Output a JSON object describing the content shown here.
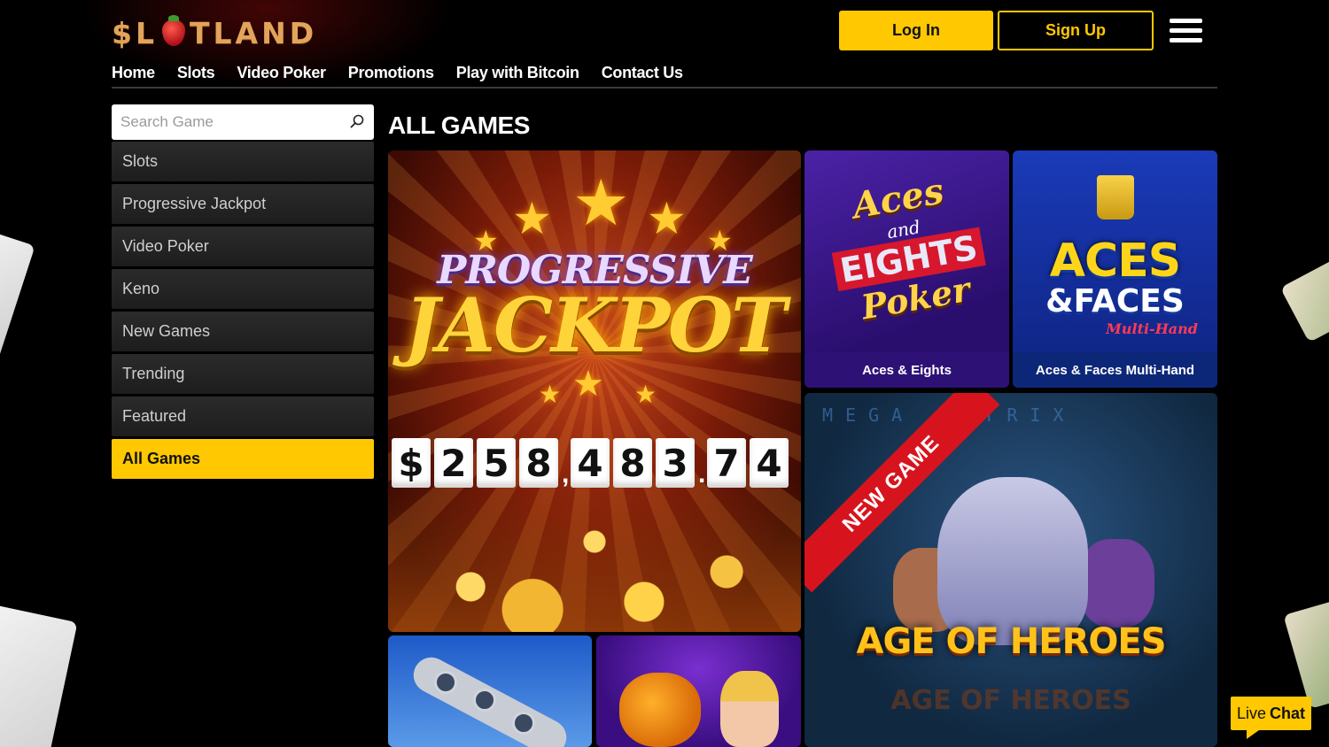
{
  "brand": {
    "logo_left": "$L",
    "logo_right": "TLAND",
    "logo_full": "SLOTLAND"
  },
  "header": {
    "login_label": "Log In",
    "signup_label": "Sign Up"
  },
  "nav": {
    "items": [
      "Home",
      "Slots",
      "Video Poker",
      "Promotions",
      "Play with Bitcoin",
      "Contact Us"
    ]
  },
  "search": {
    "placeholder": "Search Game",
    "value": ""
  },
  "sidebar": {
    "categories": [
      {
        "label": "Slots",
        "active": false
      },
      {
        "label": "Progressive Jackpot",
        "active": false
      },
      {
        "label": "Video Poker",
        "active": false
      },
      {
        "label": "Keno",
        "active": false
      },
      {
        "label": "New Games",
        "active": false
      },
      {
        "label": "Trending",
        "active": false
      },
      {
        "label": "Featured",
        "active": false
      },
      {
        "label": "All Games",
        "active": true
      }
    ]
  },
  "main": {
    "title": "ALL GAMES"
  },
  "games": {
    "jackpot": {
      "line1": "PROGRESSIVE",
      "line2": "JACKPOT",
      "amount_chars": [
        "$",
        "2",
        "5",
        "8",
        ",",
        "4",
        "8",
        "3",
        ".",
        "7",
        "4"
      ]
    },
    "aces_eights": {
      "art_l1": "Aces",
      "art_l2": "and",
      "art_l3": "EIGHTS",
      "art_l4": "Poker",
      "label": "Aces & Eights"
    },
    "aces_faces": {
      "art_l1": "ACES",
      "art_l2": "&FACES",
      "art_l3": "Multi-Hand",
      "label": "Aces & Faces Multi-Hand"
    },
    "heroes": {
      "ribbon": "NEW GAME",
      "art_title": "AGE OF HEROES",
      "art_shadow": "AGE OF HEROES",
      "matrix_text": "MEGA MATRIX"
    }
  },
  "live_chat": {
    "word1": "Live",
    "word2": "Chat"
  },
  "colors": {
    "accent": "#ffc800",
    "background": "#000000",
    "ribbon": "#d7141e"
  }
}
